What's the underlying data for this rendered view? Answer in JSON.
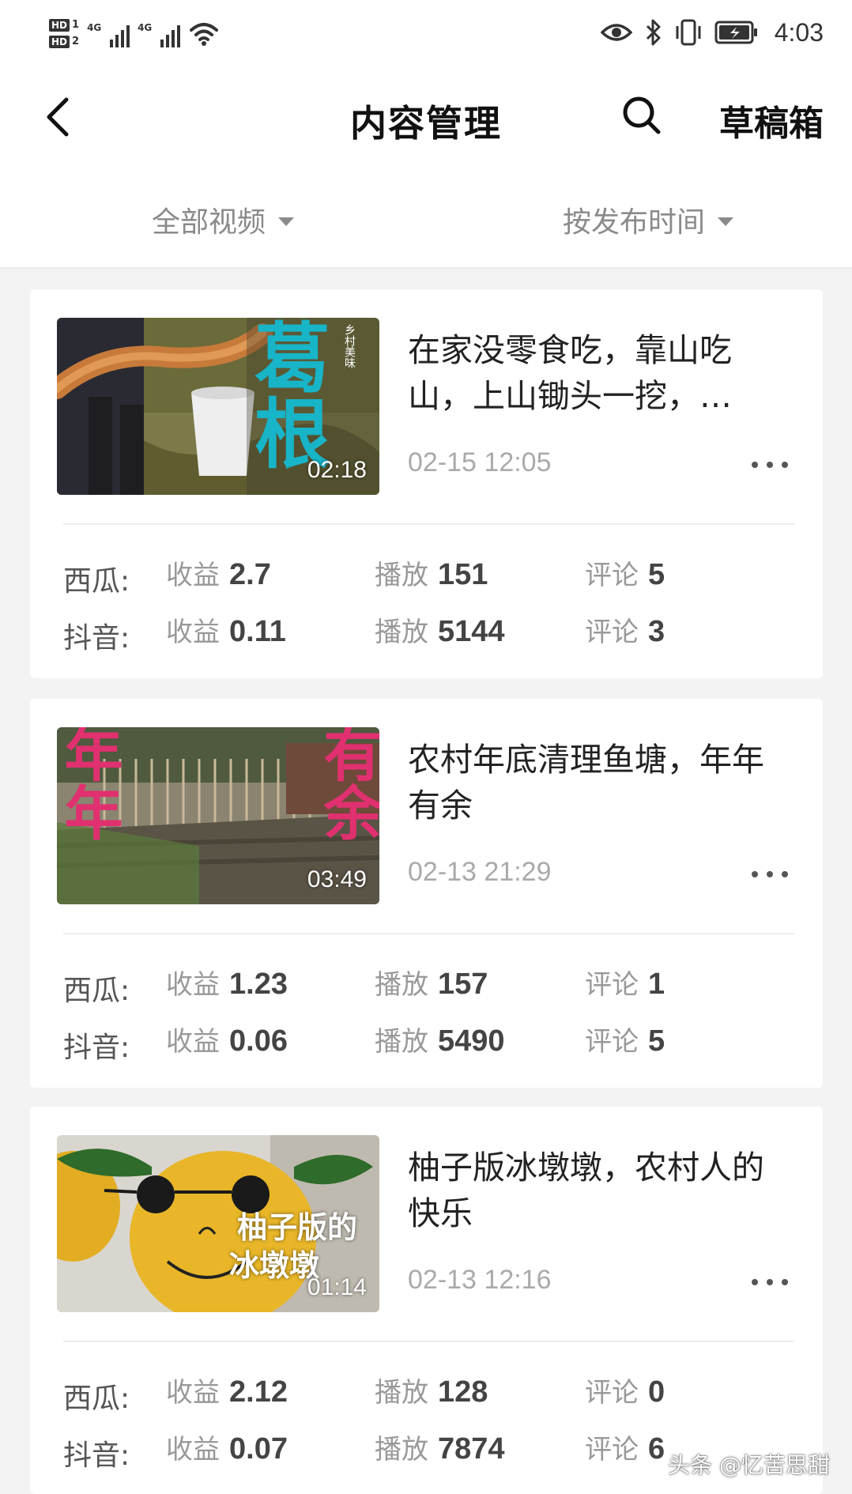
{
  "status_bar": {
    "hd1": "HD",
    "hd1_num": "1",
    "hd2": "HD",
    "hd2_num": "2",
    "network1": "4G",
    "network2": "4G",
    "time": "4:03"
  },
  "header": {
    "title": "内容管理",
    "drafts_label": "草稿箱"
  },
  "filters": {
    "type": "全部视频",
    "sort": "按发布时间"
  },
  "videos": [
    {
      "title": "在家没零食吃，靠山吃山，上山锄头一挖，…",
      "duration": "02:18",
      "date": "02-15 12:05",
      "thumb_text": "葛根",
      "thumb_small": "乡村美味",
      "stats": [
        {
          "platform": "西瓜:",
          "income_label": "收益",
          "income": "2.7",
          "plays_label": "播放",
          "plays": "151",
          "comments_label": "评论",
          "comments": "5"
        },
        {
          "platform": "抖音:",
          "income_label": "收益",
          "income": "0.11",
          "plays_label": "播放",
          "plays": "5144",
          "comments_label": "评论",
          "comments": "3"
        }
      ]
    },
    {
      "title": "农村年底清理鱼塘，年年有余",
      "duration": "03:49",
      "date": "02-13 21:29",
      "thumb_left": "年年",
      "thumb_right": "有余",
      "stats": [
        {
          "platform": "西瓜:",
          "income_label": "收益",
          "income": "1.23",
          "plays_label": "播放",
          "plays": "157",
          "comments_label": "评论",
          "comments": "1"
        },
        {
          "platform": "抖音:",
          "income_label": "收益",
          "income": "0.06",
          "plays_label": "播放",
          "plays": "5490",
          "comments_label": "评论",
          "comments": "5"
        }
      ]
    },
    {
      "title": "柚子版冰墩墩，农村人的快乐",
      "duration": "01:14",
      "date": "02-13 12:16",
      "thumb_text1": "柚子版的",
      "thumb_text2": "冰墩墩",
      "stats": [
        {
          "platform": "西瓜:",
          "income_label": "收益",
          "income": "2.12",
          "plays_label": "播放",
          "plays": "128",
          "comments_label": "评论",
          "comments": "0"
        },
        {
          "platform": "抖音:",
          "income_label": "收益",
          "income": "0.07",
          "plays_label": "播放",
          "plays": "7874",
          "comments_label": "评论",
          "comments": "6"
        }
      ]
    }
  ],
  "watermark": "头条 @忆苦思甜",
  "colors": {
    "background": "#f3f3f3",
    "card": "#ffffff",
    "accent_cyan": "#18b4c8",
    "accent_pink": "#e0306f"
  }
}
